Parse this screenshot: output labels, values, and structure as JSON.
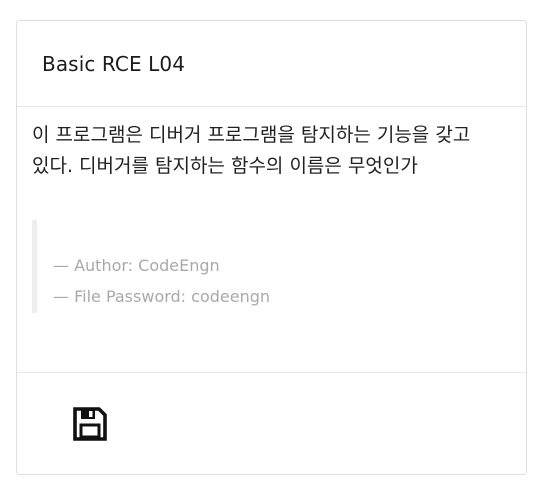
{
  "card": {
    "title": "Basic RCE L04",
    "description": "이 프로그램은 디버거 프로그램을 탐지하는 기능을 갖고 있다. 디버거를 탐지하는 함수의 이름은 무엇인가",
    "quote": {
      "author": "— Author: CodeEngn",
      "password": "— File Password: codeengn"
    },
    "footer": {
      "icon": "floppy-disk-save-icon"
    }
  }
}
